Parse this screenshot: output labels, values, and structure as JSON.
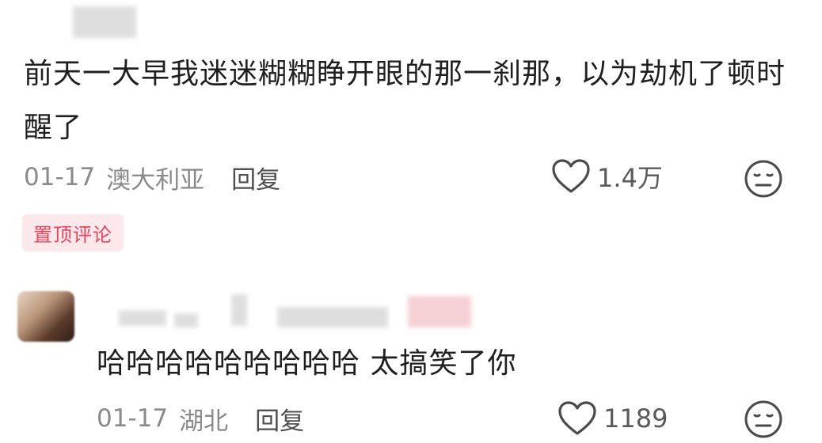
{
  "comment": {
    "text": "前天一大早我迷迷糊糊睁开眼的那一刹那，以为劫机了顿时醒了",
    "date": "01-17",
    "location": "澳大利亚",
    "reply_label": "回复",
    "like_count": "1.4万",
    "pinned_label": "置顶评论"
  },
  "reply": {
    "text": "哈哈哈哈哈哈哈哈哈 太搞笑了你",
    "date": "01-17",
    "location": "湖北",
    "reply_label": "回复",
    "like_count": "1189"
  },
  "colors": {
    "pinned_text": "#e8455d",
    "pinned_bg": "#fde8ec",
    "meta_gray": "#8a8a8a",
    "icon_gray": "#5a5a5a"
  },
  "icons": {
    "like": "heart-outline-icon",
    "dislike": "meh-face-icon"
  }
}
